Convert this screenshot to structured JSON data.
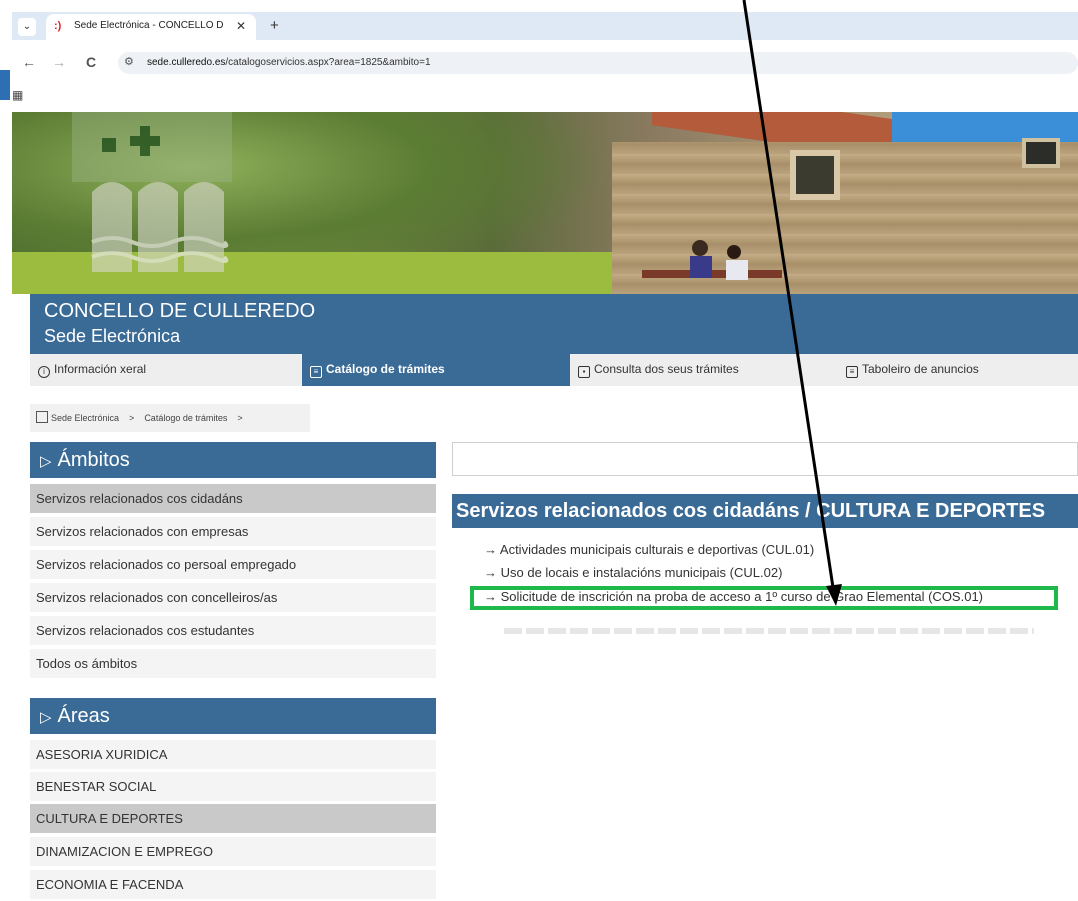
{
  "browser": {
    "tab_dropdown": "⌄",
    "tab_title": "Sede Electrónica - CONCELLO D",
    "tab_close": "✕",
    "new_tab": "+",
    "back": "←",
    "forward": "→",
    "reload": "C",
    "url_host": "sede.culleredo.es",
    "url_path": "/catalogoservicios.aspx?area=1825&ambito=1",
    "apps_icon": "apps-grid-icon"
  },
  "header": {
    "title": "CONCELLO DE CULLEREDO",
    "subtitle": "Sede Electrónica"
  },
  "main_nav": {
    "tabs": [
      {
        "label": "Información xeral",
        "icon": "info-icon"
      },
      {
        "label": "Catálogo de trámites",
        "icon": "list-icon"
      },
      {
        "label": "Consulta dos seus trámites",
        "icon": "document-icon"
      },
      {
        "label": "Taboleiro de anuncios",
        "icon": "board-icon"
      }
    ]
  },
  "breadcrumb": {
    "items": [
      "Sede Electrónica",
      "Catálogo de trámites"
    ],
    "separator": ">"
  },
  "ambitos": {
    "heading": "Ámbitos",
    "items": [
      "Servizos relacionados cos cidadáns",
      "Servizos relacionados con empresas",
      "Servizos relacionados co persoal empregado",
      "Servizos relacionados con concelleiros/as",
      "Servizos relacionados cos estudantes",
      "Todos os ámbitos"
    ],
    "selected_index": 0
  },
  "areas": {
    "heading": "Áreas",
    "items": [
      "ASESORIA XURIDICA",
      "BENESTAR SOCIAL",
      "CULTURA E DEPORTES",
      "DINAMIZACION E EMPREGO",
      "ECONOMIA E FACENDA"
    ],
    "selected_index": 2
  },
  "results": {
    "search_value": "",
    "title": "Servizos relacionados cos cidadáns / CULTURA E DEPORTES",
    "items": [
      "→ Actividades municipais culturais e deportivas (CUL.01)",
      "→ Uso de locais e instalacións municipais (CUL.02)",
      "→ Solicitude de inscrición na proba de acceso a 1º curso de Grao Elemental (COS.01)"
    ],
    "highlighted_index": 2
  },
  "colors": {
    "brand_blue": "#3a6a96",
    "highlight_green": "#1fb84a",
    "selected_grey": "#c9c9c9"
  }
}
